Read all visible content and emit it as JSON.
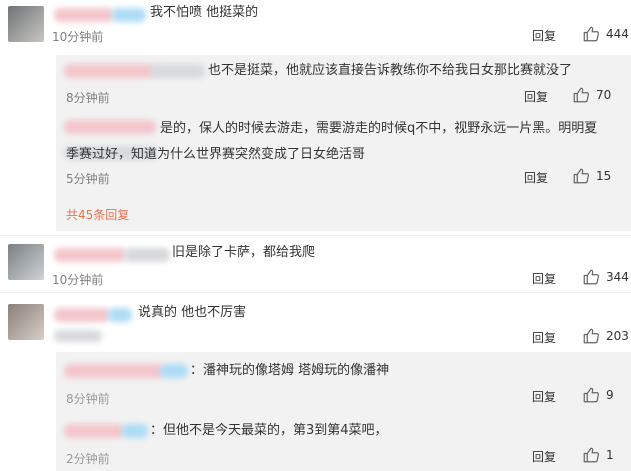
{
  "comments": [
    {
      "text": "我不怕喷  他挺菜的",
      "time": "10分钟前",
      "reply": "回复",
      "likes": "444"
    },
    {
      "text": "说真的 他也不厉害",
      "time": "",
      "reply": "回复",
      "likes": "203"
    },
    {
      "text": "旧是除了卡萨，都给我爬",
      "time": "10分钟前",
      "reply": "回复",
      "likes": "344"
    }
  ],
  "replies_first": [
    {
      "text": "也不是挺菜，他就应该直接告诉教练你不给我日女那比赛就没了",
      "time": "8分钟前",
      "reply": "回复",
      "likes": "70"
    },
    {
      "text_line1": "是的，保人的时候去游走，需要游走的时候q不中，视野永远一片黑。明明夏",
      "text_line2": "季赛过好，知道为什么世界赛突然变成了日女绝活哥",
      "time": "5分钟前",
      "reply": "回复",
      "likes": "15"
    }
  ],
  "more_replies": "共45条回复",
  "replies_second": [
    {
      "text": "：潘神玩的像塔姆 塔姆玩的像潘神",
      "time": "8分钟前",
      "reply": "回复",
      "likes": "9"
    },
    {
      "text": "：但他不是今天最菜的，第3到第4菜吧，",
      "time": "2分钟前",
      "reply": "回复",
      "likes": "1"
    }
  ],
  "icons": {
    "like": "thumbs-up-icon"
  }
}
